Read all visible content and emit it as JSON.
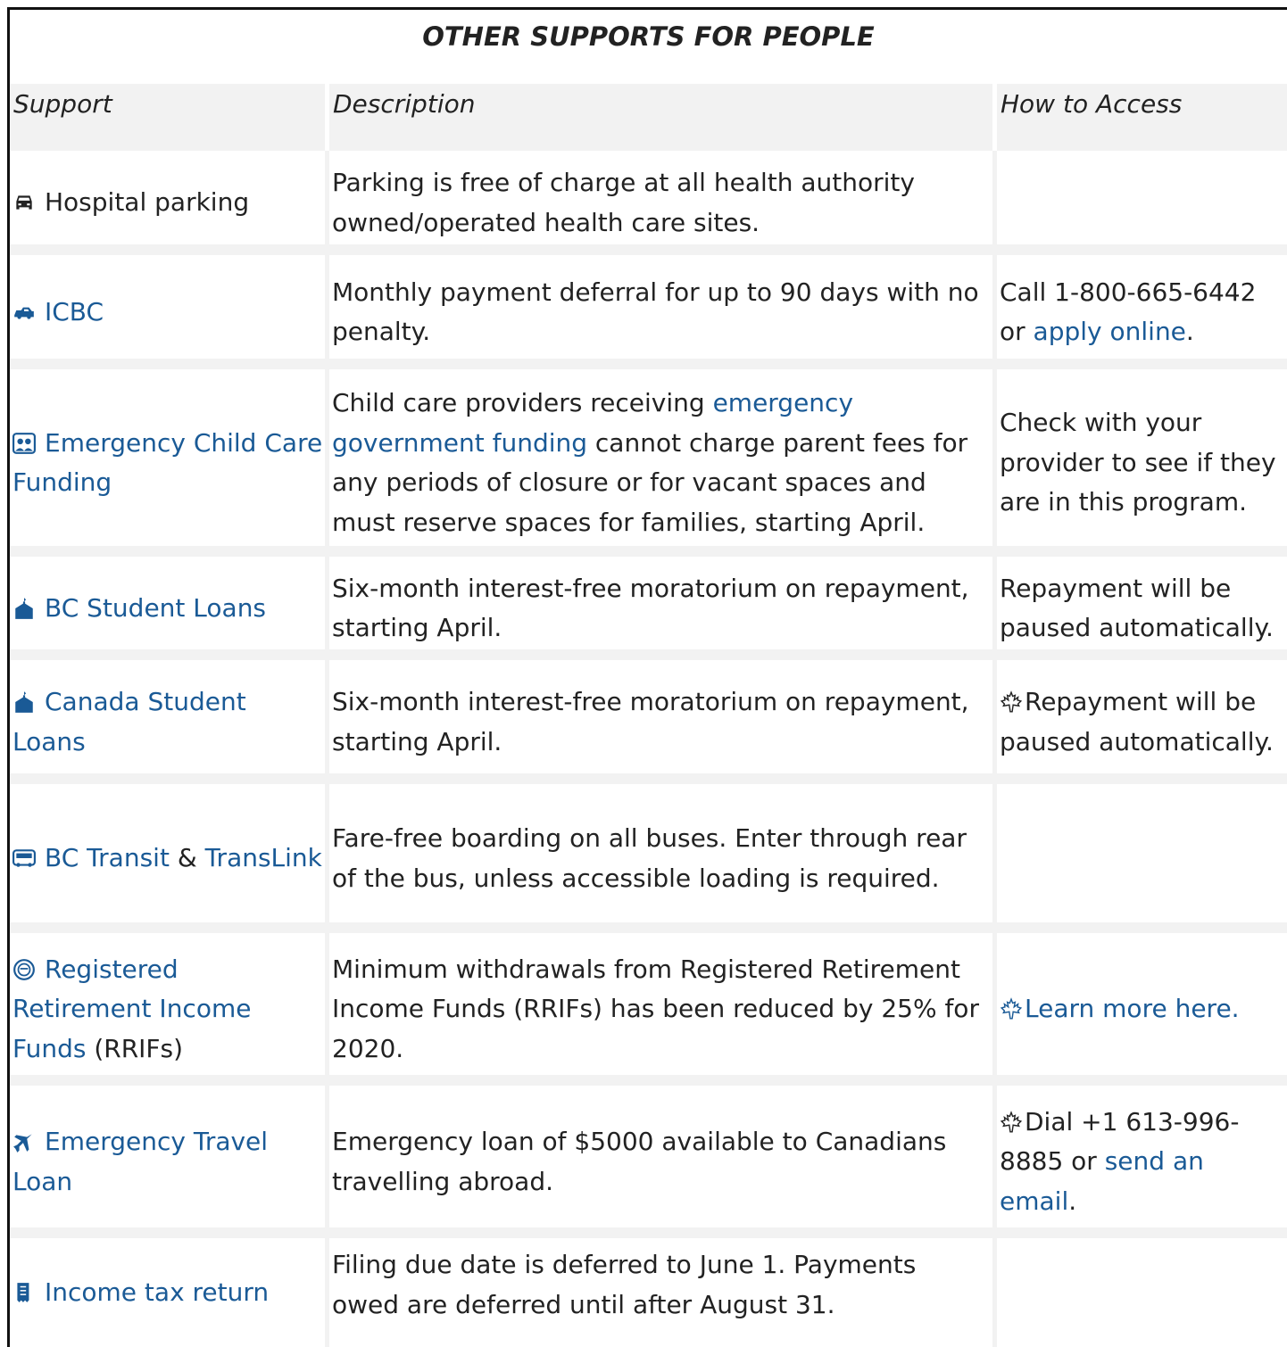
{
  "title": "OTHER SUPPORTS FOR PEOPLE",
  "headers": [
    "Support",
    "Description",
    "How to Access"
  ],
  "rows": [
    {
      "icon": "car-icon",
      "support": "Hospital parking",
      "description": "Parking is free of charge at all health authority owned/operated health care sites.",
      "access": ""
    },
    {
      "icon": "car-side-icon",
      "support": "ICBC",
      "description": "Monthly payment deferral for up to 90 days with no penalty.",
      "access_pre": "Call 1-800-665-6442 or ",
      "access_link": "apply online",
      "access_post": "."
    },
    {
      "icon": "children-icon",
      "support": "Emergency Child Care Funding",
      "description_pre": "Child care providers receiving ",
      "description_link": "emergency government funding",
      "description_post": " cannot charge parent fees for any periods of closure or for vacant spaces and must reserve spaces for families, starting April.",
      "access": "Check with your provider to see if they are in this program."
    },
    {
      "icon": "school-icon",
      "support": "BC Student Loans",
      "description": "Six-month interest-free moratorium on repayment, starting April.",
      "access": "Repayment will be paused automatically."
    },
    {
      "icon": "school-icon",
      "support": "Canada Student Loans",
      "description": "Six-month interest-free moratorium on repayment, starting April.",
      "access_icon": "maple-leaf-icon",
      "access": "Repayment will be paused automatically."
    },
    {
      "icon": "bus-icon",
      "support_link1": "BC Transit",
      "support_amp": " & ",
      "support_link2": "TransLink",
      "description": "Fare-free boarding on all buses. Enter through rear of the bus, unless accessible loading is required.",
      "access": ""
    },
    {
      "icon": "senior-face-icon",
      "support_link": "Registered Retirement Income Funds",
      "support_post": " (RRIFs)",
      "description": "Minimum withdrawals from Registered Retirement Income Funds (RRIFs) has been reduced by 25% for 2020.",
      "access_icon": "maple-leaf-icon",
      "access_link": "Learn more here."
    },
    {
      "icon": "airplane-icon",
      "support": "Emergency Travel Loan",
      "description": "Emergency loan of $5000 available to Canadians travelling abroad.",
      "access_icon": "maple-leaf-icon",
      "access_pre": "Dial +1 613-996-8885 or ",
      "access_link": "send an email",
      "access_post": "."
    },
    {
      "icon": "receipt-icon",
      "support": "Income tax return",
      "description": "Filing due date is deferred to June 1. Payments owed are deferred until after August 31.",
      "access": ""
    }
  ]
}
